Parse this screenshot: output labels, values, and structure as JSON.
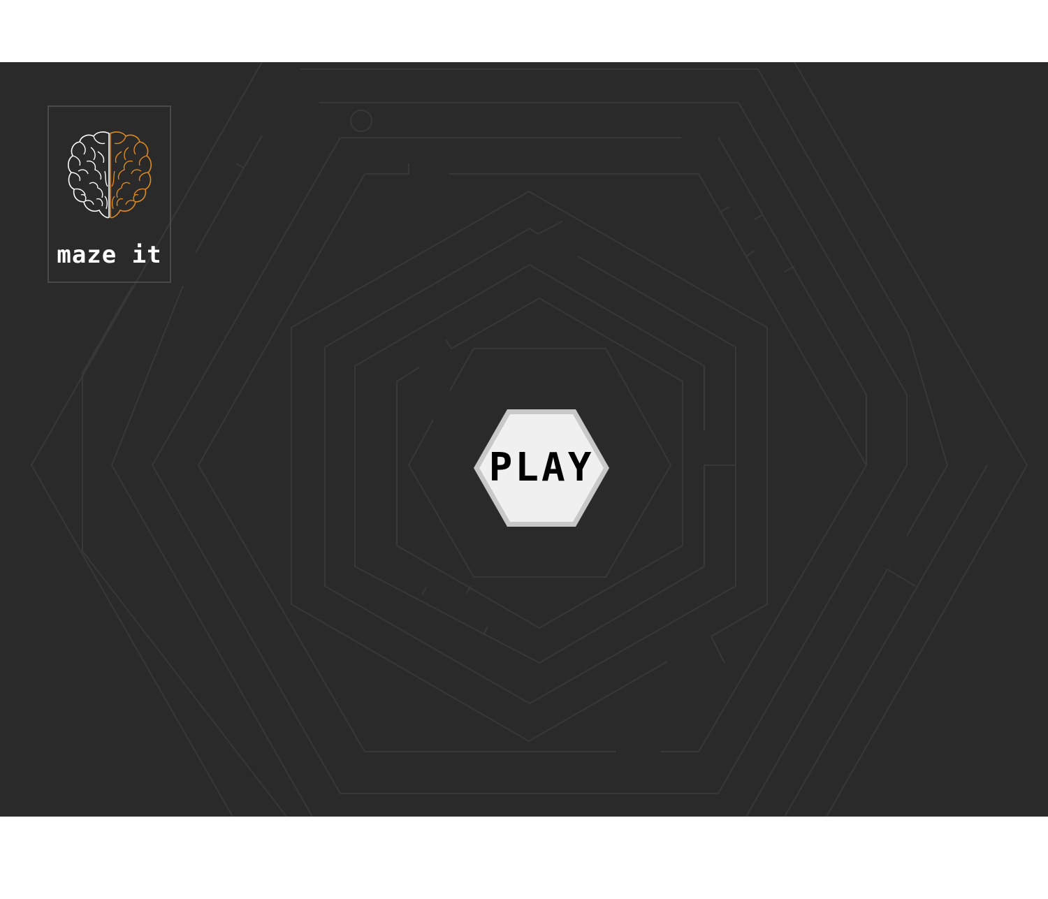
{
  "app": {
    "logo_text": "maze it",
    "play_label": "PLAY"
  },
  "icons": {
    "logo": "brain-icon"
  },
  "colors": {
    "background": "#2a2a2a",
    "maze_lines": "#383838",
    "brain_left": "#ffffff",
    "brain_right": "#e08a1e",
    "play_fill": "#f0f0f0",
    "play_border": "#c8c8c8"
  }
}
